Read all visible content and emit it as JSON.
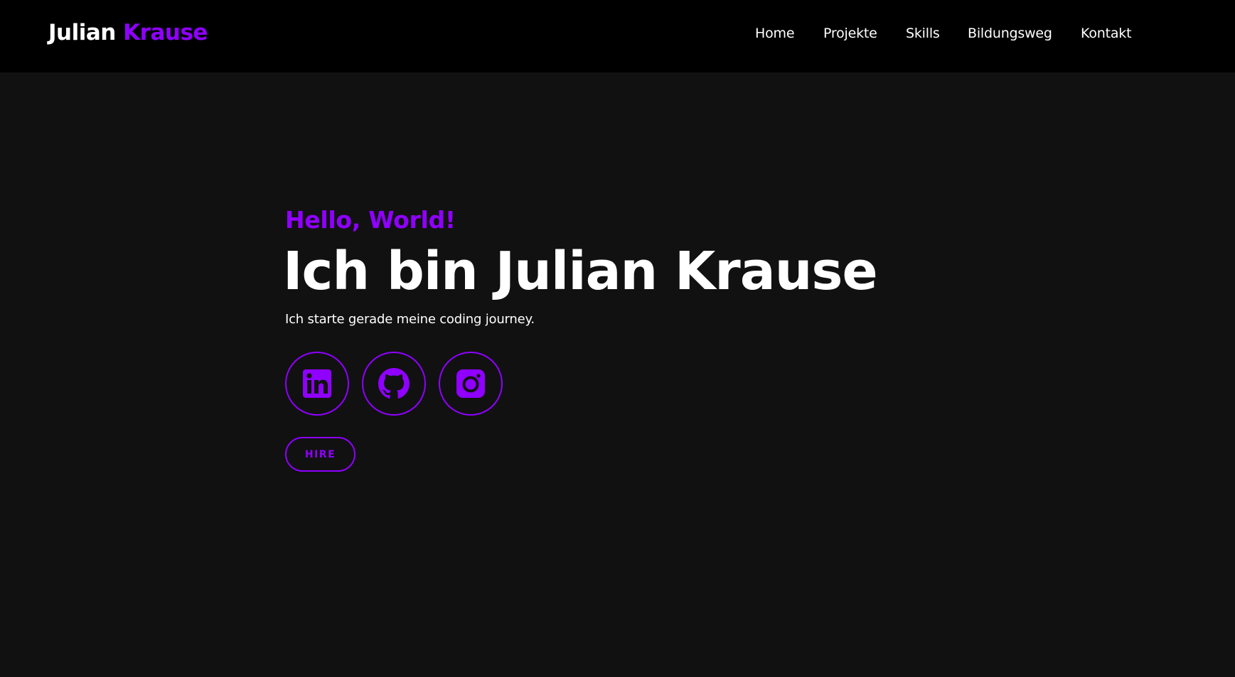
{
  "header": {
    "logo_first": "Julian",
    "logo_last": "Krause",
    "nav": [
      {
        "label": "Home",
        "icon": null
      },
      {
        "label": "Projekte",
        "icon": null
      },
      {
        "label": "Skills",
        "icon": null
      },
      {
        "label": "Bildungsweg",
        "icon": null
      },
      {
        "label": "Kontakt",
        "icon": null
      }
    ]
  },
  "hero": {
    "greeting": "Hello, World!",
    "headline": "Ich bin Julian Krause",
    "tagline": "Ich starte gerade meine coding journey.",
    "social": [
      {
        "icon": "linkedin-icon"
      },
      {
        "icon": "github-icon"
      },
      {
        "icon": "instagram-icon"
      }
    ],
    "hire_label": "HIRE"
  },
  "colors": {
    "accent": "#8f00ff",
    "header_background": "#000000",
    "page_background": "#111111",
    "text": "#ffffff"
  }
}
